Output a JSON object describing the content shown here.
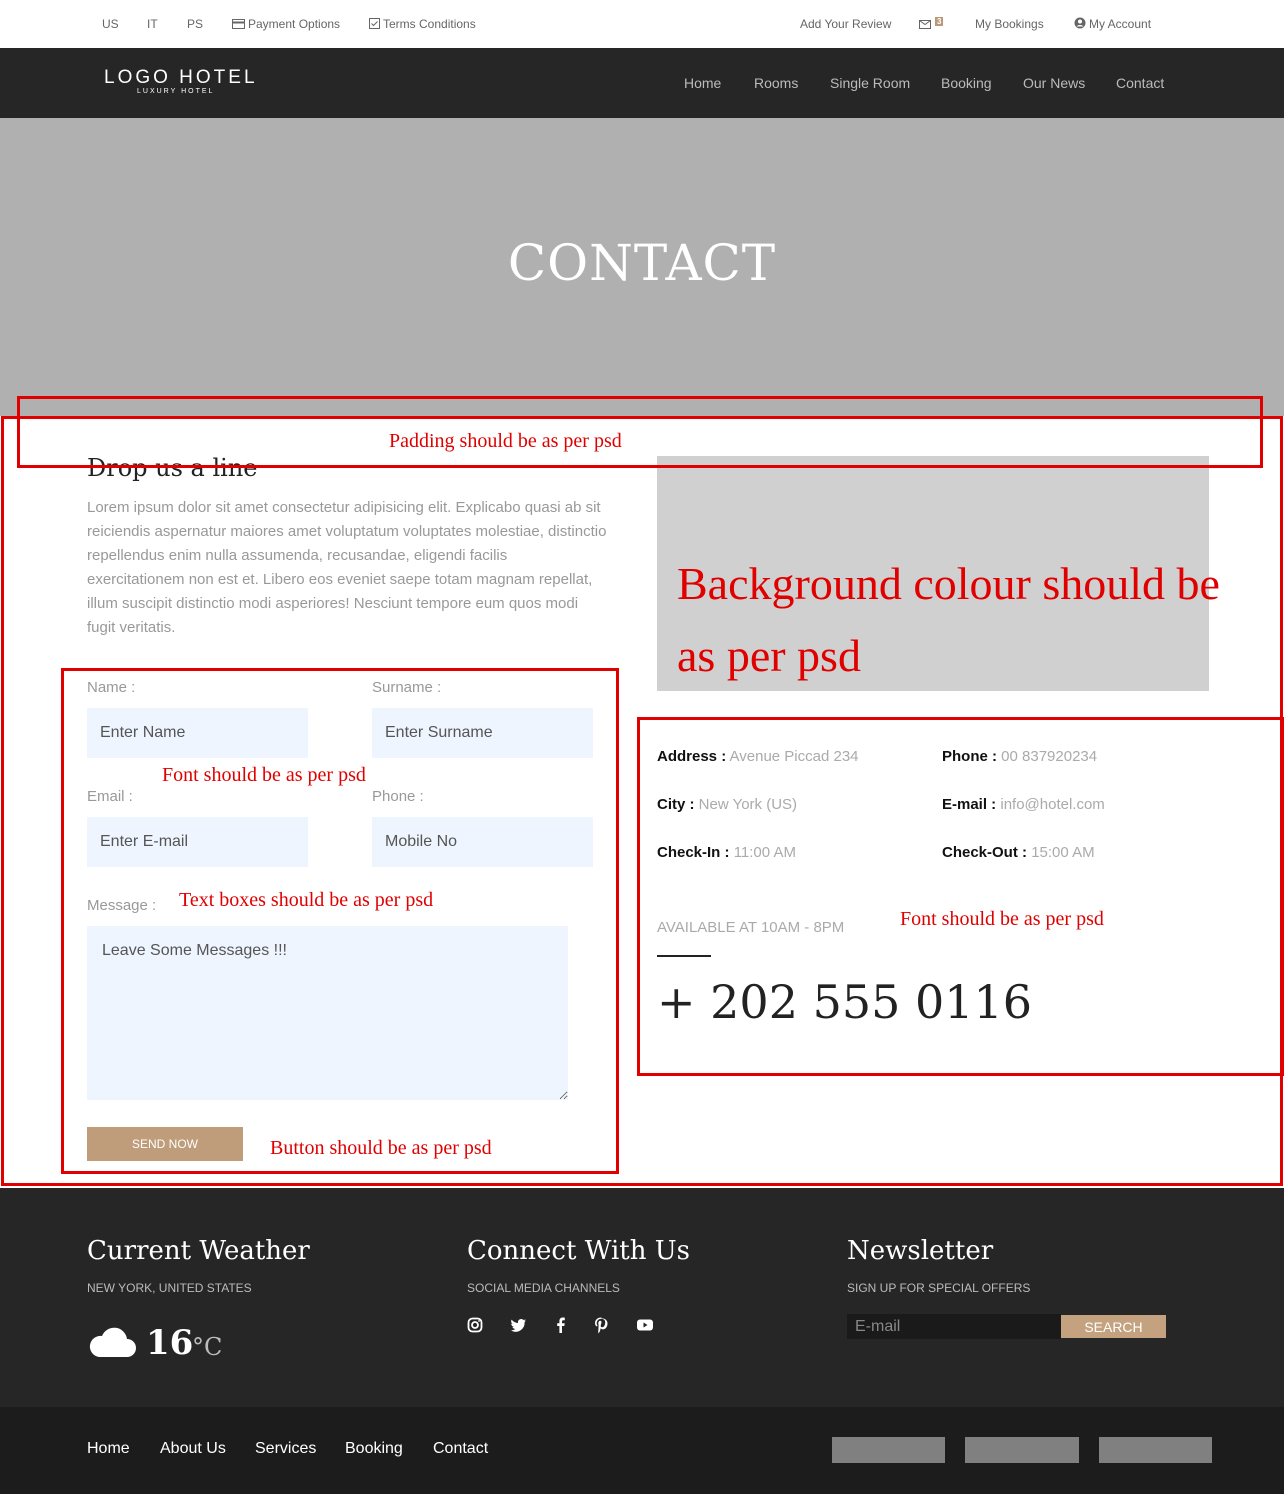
{
  "topbar": {
    "lang": [
      "US",
      "IT",
      "PS"
    ],
    "payment": "Payment Options",
    "terms": "Terms Conditions",
    "review": "Add Your Review",
    "mail_count": "3",
    "bookings": "My Bookings",
    "account": "My Account"
  },
  "nav": {
    "logo": "LOGO HOTEL",
    "logo_sub": "LUXURY HOTEL",
    "links": [
      "Home",
      "Rooms",
      "Single Room",
      "Booking",
      "Our News",
      "Contact"
    ]
  },
  "hero": {
    "title": "CONTACT"
  },
  "annotations": {
    "padding": "Padding should be as per psd",
    "bg_line1": "Background colour should be",
    "bg_line2": "as per psd",
    "font1": "Font should be as per psd",
    "textboxes": "Text boxes should be as per psd",
    "button": "Button should be as per psd",
    "font2": "Font should be as per psd"
  },
  "contact": {
    "heading": "Drop us a line",
    "paragraph": "Lorem ipsum dolor sit amet consectetur adipisicing elit. Explicabo quasi ab sit reiciendis aspernatur maiores amet voluptatum voluptates molestiae, distinctio repellendus enim nulla assumenda, recusandae, eligendi facilis exercitationem non est et. Libero eos eveniet saepe totam magnam repellat, illum suscipit distinctio modi asperiores! Nesciunt tempore eum quos modi fugit veritatis.",
    "name_label": "Name :",
    "name_placeholder": "Enter Name",
    "surname_label": "Surname :",
    "surname_placeholder": "Enter Surname",
    "email_label": "Email :",
    "email_placeholder": "Enter E-mail",
    "phone_label": "Phone :",
    "phone_placeholder": "Mobile No",
    "message_label": "Message :",
    "message_placeholder": "Leave Some Messages !!!",
    "send": "SEND NOW"
  },
  "info": {
    "address_label": "Address :",
    "address": "Avenue Piccad 234",
    "phone_label": "Phone :",
    "phone": "00 837920234",
    "city_label": "City :",
    "city": "New York (US)",
    "email_label": "E-mail :",
    "email": "info@hotel.com",
    "checkin_label": "Check-In :",
    "checkin": "11:00 AM",
    "checkout_label": "Check-Out :",
    "checkout": "15:00 AM",
    "available": "AVAILABLE AT 10AM - 8PM",
    "big_phone": "+ 202 555 0116"
  },
  "footer": {
    "weather_title": "Current Weather",
    "weather_sub": "NEW YORK, UNITED STATES",
    "temp": "16",
    "unit": "°C",
    "connect_title": "Connect With Us",
    "connect_sub": "SOCIAL MEDIA CHANNELS",
    "news_title": "Newsletter",
    "news_sub": "SIGN UP FOR SPECIAL OFFERS",
    "news_placeholder": "E-mail",
    "news_button": "SEARCH",
    "links": [
      "Home",
      "About Us",
      "Services",
      "Booking",
      "Contact"
    ]
  },
  "colors": {
    "accent": "#bf9c7a",
    "annotation": "#e00000",
    "dark": "#262626"
  }
}
